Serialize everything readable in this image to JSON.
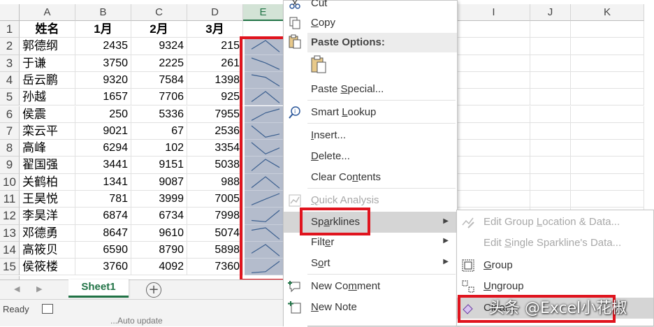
{
  "columns": [
    "A",
    "B",
    "C",
    "D",
    "E",
    "I",
    "J",
    "K"
  ],
  "selected_column": "E",
  "header_row": {
    "row": "1",
    "cells": [
      "姓名",
      "1月",
      "2月",
      "3月"
    ]
  },
  "rows": [
    {
      "row": "2",
      "name": "郭德纲",
      "jan": "2435",
      "feb": "9324",
      "mar": "215"
    },
    {
      "row": "3",
      "name": "于谦",
      "jan": "3750",
      "feb": "2225",
      "mar": "261"
    },
    {
      "row": "4",
      "name": "岳云鹏",
      "jan": "9320",
      "feb": "7584",
      "mar": "1398"
    },
    {
      "row": "5",
      "name": "孙越",
      "jan": "1657",
      "feb": "7706",
      "mar": "925"
    },
    {
      "row": "6",
      "name": "侯震",
      "jan": "250",
      "feb": "5336",
      "mar": "7955"
    },
    {
      "row": "7",
      "name": "栾云平",
      "jan": "9021",
      "feb": "67",
      "mar": "2536"
    },
    {
      "row": "8",
      "name": "高峰",
      "jan": "6294",
      "feb": "102",
      "mar": "3354"
    },
    {
      "row": "9",
      "name": "翟国强",
      "jan": "3441",
      "feb": "9151",
      "mar": "5038"
    },
    {
      "row": "10",
      "name": "关鹤柏",
      "jan": "1341",
      "feb": "9087",
      "mar": "988"
    },
    {
      "row": "11",
      "name": "王昊悦",
      "jan": "781",
      "feb": "3999",
      "mar": "7005"
    },
    {
      "row": "12",
      "name": "李昊洋",
      "jan": "6874",
      "feb": "6734",
      "mar": "7998"
    },
    {
      "row": "13",
      "name": "邓德勇",
      "jan": "8647",
      "feb": "9610",
      "mar": "5074"
    },
    {
      "row": "14",
      "name": "高筱贝",
      "jan": "6590",
      "feb": "8790",
      "mar": "5898"
    },
    {
      "row": "15",
      "name": "侯筱楼",
      "jan": "3760",
      "feb": "4092",
      "mar": "7360"
    }
  ],
  "sheet_tab": "Sheet1",
  "add_sheet_icon": "plus-circle-icon",
  "status": "Ready",
  "ghost_text": "...Auto update",
  "context_menu": {
    "cut": "Cut",
    "copy": "Copy",
    "paste_options": "Paste Options:",
    "paste_special": "Paste Special...",
    "smart_lookup": "Smart Lookup",
    "insert": "Insert...",
    "delete": "Delete...",
    "clear_contents": "Clear Contents",
    "quick_analysis": "Quick Analysis",
    "sparklines": "Sparklines",
    "filter": "Filter",
    "sort": "Sort",
    "new_comment": "New Comment",
    "new_note": "New Note"
  },
  "sparklines_submenu": {
    "edit_group": "Edit Group Location & Data...",
    "edit_single": "Edit Single Sparkline's Data...",
    "group": "Group",
    "ungroup": "Ungroup",
    "clear": "Clear"
  },
  "watermark": "头条 @Excel小花椒",
  "colors": {
    "excel_green": "#217346",
    "highlight_red": "#e0141e",
    "sparkline_bg": "#b4bccc",
    "sparkline_line": "#3b5f8f"
  }
}
